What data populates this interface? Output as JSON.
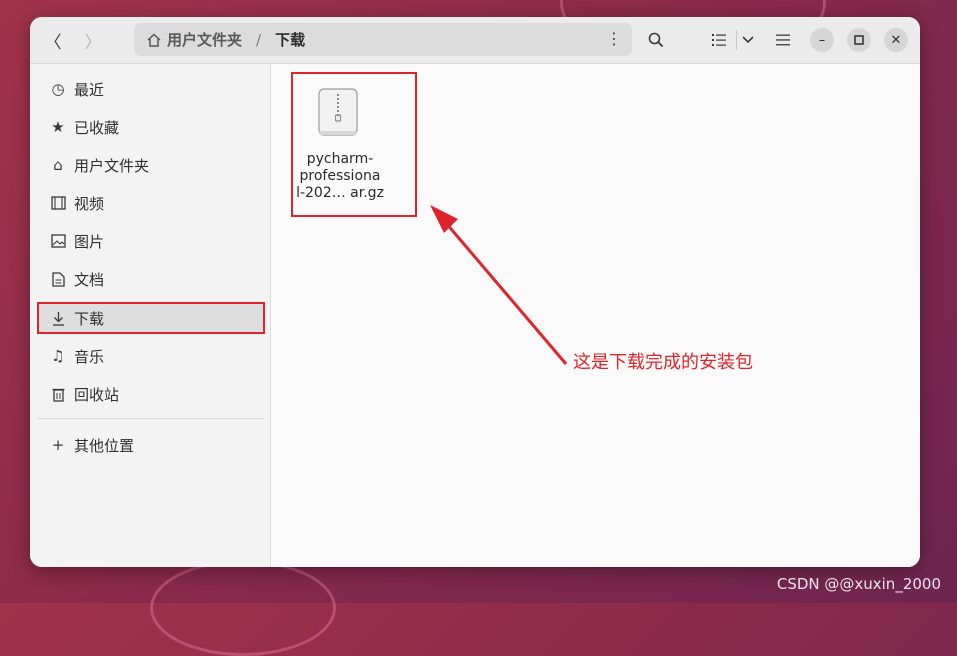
{
  "window": {
    "breadcrumb": {
      "home": "用户文件夹",
      "separator": "/",
      "current": "下载"
    },
    "header_icons": [
      "back-icon",
      "forward-icon",
      "home-icon",
      "more-vertical-icon",
      "search-icon",
      "list-view-icon",
      "chevron-down-icon",
      "hamburger-menu-icon",
      "minimize-icon",
      "maximize-icon",
      "close-icon"
    ]
  },
  "sidebar": {
    "items": [
      {
        "label": "最近",
        "icon": "clock-icon"
      },
      {
        "label": "已收藏",
        "icon": "star-icon"
      },
      {
        "label": "用户文件夹",
        "icon": "home-icon"
      },
      {
        "label": "视频",
        "icon": "film-icon"
      },
      {
        "label": "图片",
        "icon": "image-icon"
      },
      {
        "label": "文档",
        "icon": "document-icon"
      },
      {
        "label": "下载",
        "icon": "download-icon",
        "active": true
      },
      {
        "label": "音乐",
        "icon": "music-icon"
      },
      {
        "label": "回收站",
        "icon": "trash-icon"
      }
    ],
    "other": {
      "label": "其他位置",
      "icon": "plus-icon"
    }
  },
  "files": [
    {
      "name_lines": [
        "pycharm-",
        "professiona",
        "l-202… ar.gz"
      ],
      "icon": "archive-icon"
    }
  ],
  "annotation": {
    "text": "这是下载完成的安装包",
    "color": "#e0242b"
  },
  "watermark": "CSDN @@xuxin_2000"
}
